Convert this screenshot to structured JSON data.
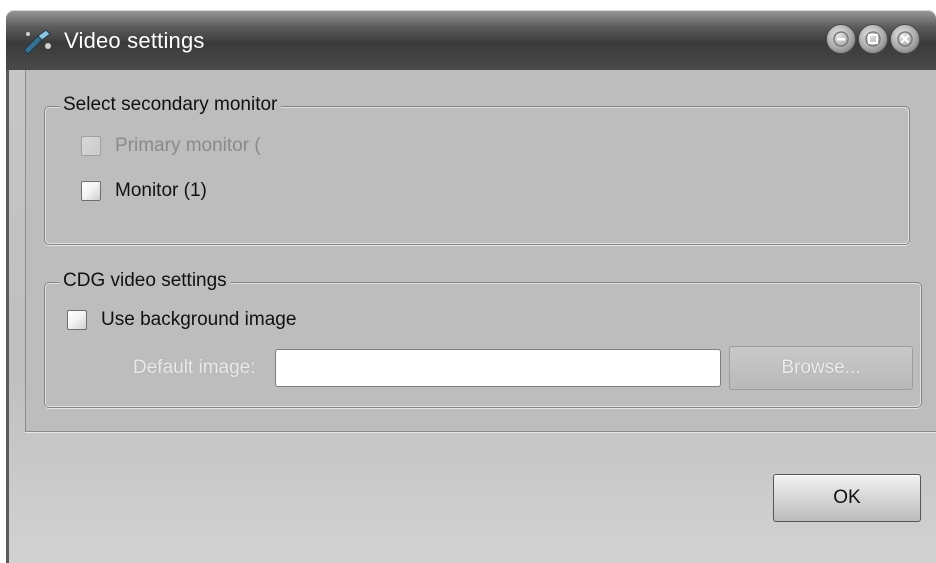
{
  "window": {
    "title": "Video settings",
    "controls": [
      "minimize-icon",
      "maximize-icon",
      "close-icon"
    ]
  },
  "secondary_monitor": {
    "title": "Select secondary monitor",
    "options": [
      {
        "label": "Primary monitor (",
        "checked": false,
        "enabled": false
      },
      {
        "label": "Monitor (1)",
        "checked": false,
        "enabled": true
      }
    ]
  },
  "cdg": {
    "title": "CDG video settings",
    "use_background_label": "Use background image",
    "use_background_checked": false,
    "default_image_label": "Default image:",
    "default_image_value": "",
    "browse_label": "Browse..."
  },
  "footer": {
    "ok_label": "OK"
  },
  "colors": {
    "titlebar": "#3a3a3a",
    "body": "#c0c0c0"
  }
}
